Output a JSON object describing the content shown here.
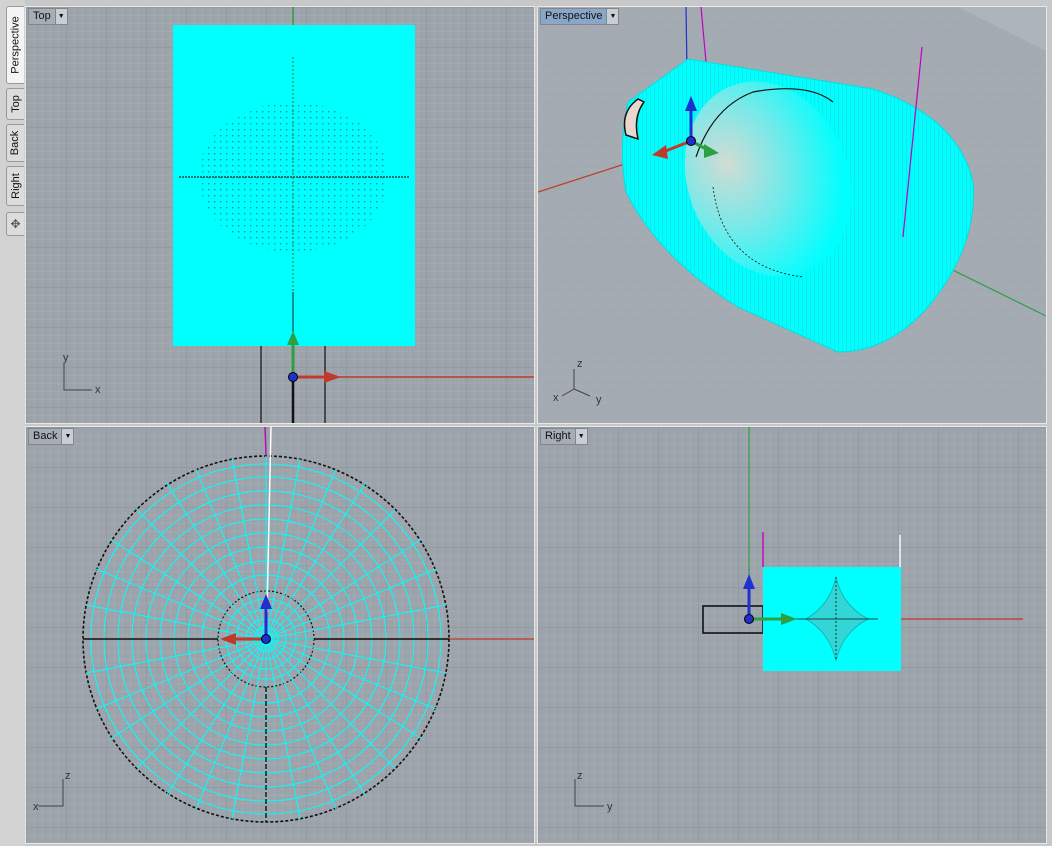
{
  "side_tabs": [
    {
      "label": "Perspective",
      "active": true
    },
    {
      "label": "Top",
      "active": false
    },
    {
      "label": "Back",
      "active": false
    },
    {
      "label": "Right",
      "active": false
    }
  ],
  "side_tab_extra_icon": "crosshair-icon",
  "viewports": {
    "top": {
      "title": "Top",
      "axis_labels": {
        "vertical": "y",
        "horizontal": "x"
      }
    },
    "perspective": {
      "title": "Perspective",
      "axis_labels": {
        "up": "z",
        "left": "x",
        "right": "y"
      }
    },
    "back": {
      "title": "Back",
      "axis_labels": {
        "vertical": "z",
        "horizontal": "x"
      }
    },
    "right": {
      "title": "Right",
      "axis_labels": {
        "vertical": "z",
        "horizontal": "y"
      }
    }
  },
  "colors": {
    "viewport_bg": "#9ca3ab",
    "grid_minor": "#a9b0b7",
    "grid_major": "#8b9299",
    "object": "#00ffff",
    "x_axis": "#c0392b",
    "y_axis": "#2ea043",
    "z_axis": "#1f2fd0",
    "marker": "#c000c0"
  }
}
